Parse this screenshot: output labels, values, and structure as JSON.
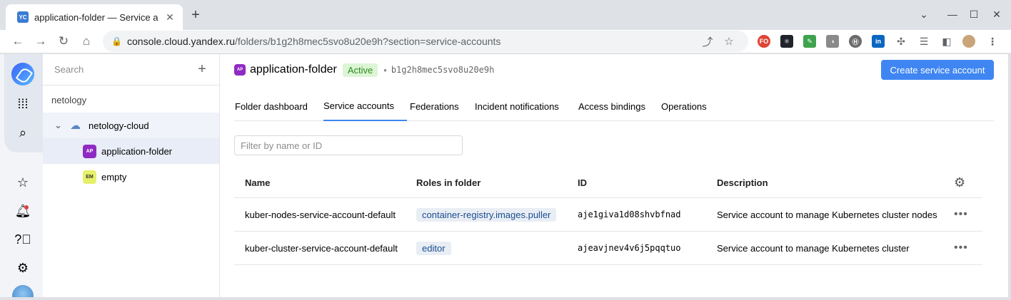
{
  "browser": {
    "tab_title": "application-folder — Service a",
    "tab_favicon": "YC",
    "url_host": "console.cloud.yandex.ru",
    "url_path": "/folders/b1g2h8mec5svo8u20e9h?section=service-accounts",
    "extensions": [
      {
        "name": "fo-extension-icon",
        "label": "FO",
        "color": "#e04434"
      },
      {
        "name": "react-devtools-icon",
        "label": "⚛",
        "color": "#20232a"
      },
      {
        "name": "green-extension-icon",
        "label": "✎",
        "color": "#3fa34d"
      },
      {
        "name": "android-extension-icon",
        "label": "◑",
        "color": "#8a8a8a"
      },
      {
        "name": "h-extension-icon",
        "label": "Ⓗ",
        "color": "#6b6b6b"
      },
      {
        "name": "linkedin-icon",
        "label": "in",
        "color": "#0a66c2"
      }
    ]
  },
  "sidebar": {
    "search_placeholder": "Search",
    "cloud_group": "netology",
    "items": [
      {
        "label": "netology-cloud"
      },
      {
        "label": "application-folder",
        "badge": "AP",
        "badge_bg": "#8f2ac3",
        "badge_fg": "#ffffff"
      },
      {
        "label": "empty",
        "badge": "EM",
        "badge_bg": "#e6f06b",
        "badge_fg": "#333333"
      }
    ]
  },
  "header": {
    "badge": "AP",
    "title": "application-folder",
    "status": "Active",
    "folder_id": "b1g2h8mec5svo8u20e9h",
    "create_button": "Create service account"
  },
  "tabs": [
    {
      "label": "Folder dashboard"
    },
    {
      "label": "Service accounts",
      "active": true
    },
    {
      "label": "Federations"
    },
    {
      "label": "Incident notifications"
    },
    {
      "label": "Access bindings"
    },
    {
      "label": "Operations"
    }
  ],
  "filter": {
    "placeholder": "Filter by name or ID"
  },
  "table": {
    "columns": [
      "Name",
      "Roles in folder",
      "ID",
      "Description"
    ],
    "rows": [
      {
        "name": "kuber-nodes-service-account-default",
        "role": "container-registry.images.puller",
        "id": "aje1giva1d08shvbfnad",
        "description": "Service account to manage Kubernetes cluster nodes"
      },
      {
        "name": "kuber-cluster-service-account-default",
        "role": "editor",
        "id": "ajeavjnev4v6j5pqqtuo",
        "description": "Service account to manage Kubernetes cluster"
      }
    ]
  }
}
